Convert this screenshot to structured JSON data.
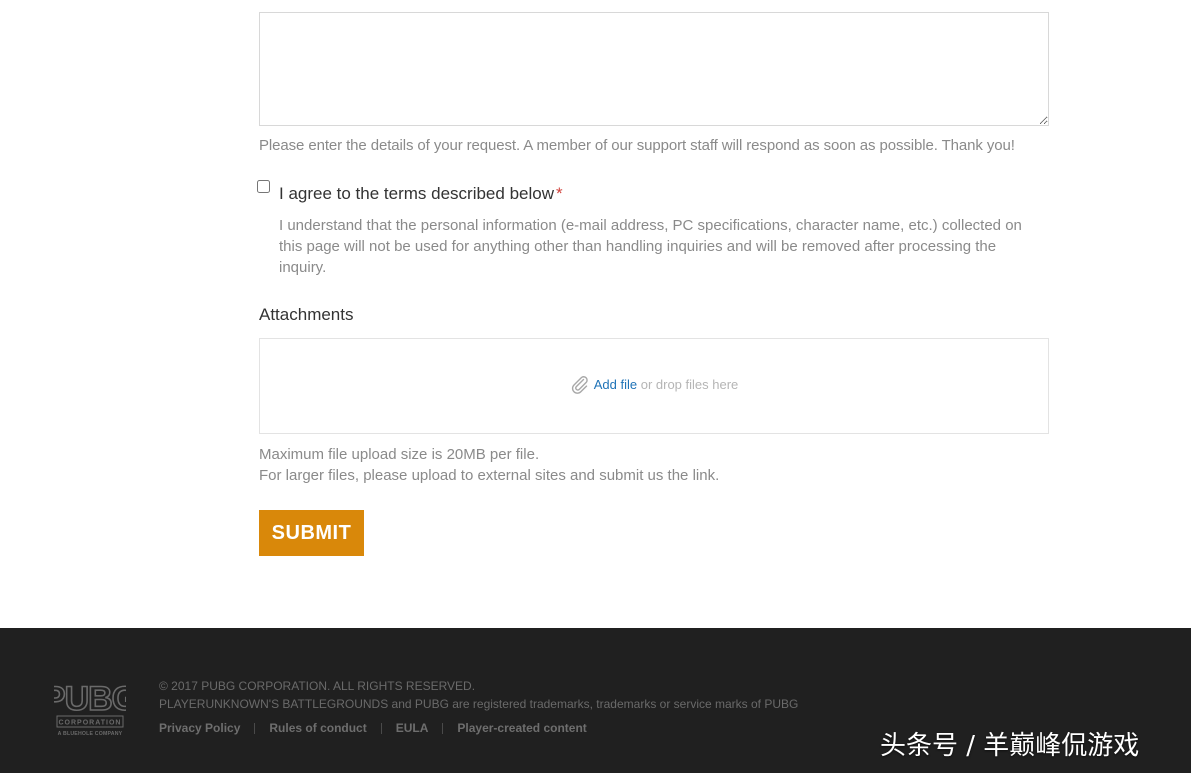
{
  "form": {
    "description_value": "",
    "description_help": "Please enter the details of your request. A member of our support staff will respond as soon as possible. Thank you!",
    "agree_label": "I agree to the terms described below",
    "required_mark": "*",
    "agree_checked": false,
    "agree_detail": "I understand that the personal information (e-mail address, PC specifications, character name, etc.) collected on this page will not be used for anything other than handling inquiries and will be removed after processing the inquiry.",
    "attachments_title": "Attachments",
    "add_file_label": "Add file",
    "drop_hint": "or drop files here",
    "size_note_line1": "Maximum file upload size is 20MB per file.",
    "size_note_line2": "For larger files, please upload to external sites and submit us the link.",
    "submit_label": "SUBMIT",
    "submit_color": "#d9880a",
    "icons": {
      "attach": "paperclip-icon"
    }
  },
  "footer": {
    "logo_text": "PUBG",
    "logo_sub": "CORPORATION",
    "logo_tagline": "A BLUEHOLE COMPANY",
    "copyright": "© 2017 PUBG CORPORATION. ALL RIGHTS RESERVED.",
    "trademark": "PLAYERUNKNOWN'S BATTLEGROUNDS and PUBG are registered trademarks, trademarks or service marks of PUBG",
    "links": [
      "Privacy Policy",
      "Rules of conduct",
      "EULA",
      "Player-created content"
    ],
    "background": "#202020"
  },
  "watermark": "头条号 / 羊巅峰侃游戏"
}
